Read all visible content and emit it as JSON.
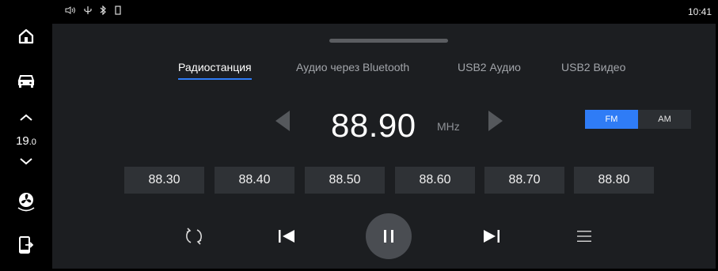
{
  "status": {
    "time": "10:41"
  },
  "climate": {
    "temp_main": "19",
    "temp_decimal": ".0"
  },
  "tabs": [
    {
      "label": "Радиостанция",
      "active": true
    },
    {
      "label": "Аудио через Bluetooth",
      "active": false
    },
    {
      "label": "USB2 Аудио",
      "active": false
    },
    {
      "label": "USB2 Видео",
      "active": false
    }
  ],
  "radio": {
    "frequency": "88.90",
    "unit": "MHz",
    "band_fm": "FM",
    "band_am": "AM",
    "selected_band": "FM",
    "presets": [
      "88.30",
      "88.40",
      "88.50",
      "88.60",
      "88.70",
      "88.80"
    ]
  },
  "colors": {
    "accent": "#2f7cf6",
    "panel": "#1c1e21",
    "preset_bg": "#2f3236"
  },
  "icons": [
    "home-icon",
    "car-icon",
    "chevron-up-icon",
    "chevron-down-icon",
    "fan-icon",
    "phone-exit-icon",
    "volume-icon",
    "usb-icon",
    "bluetooth-icon",
    "battery-icon",
    "loop-icon",
    "previous-icon",
    "pause-icon",
    "next-icon",
    "list-icon"
  ]
}
